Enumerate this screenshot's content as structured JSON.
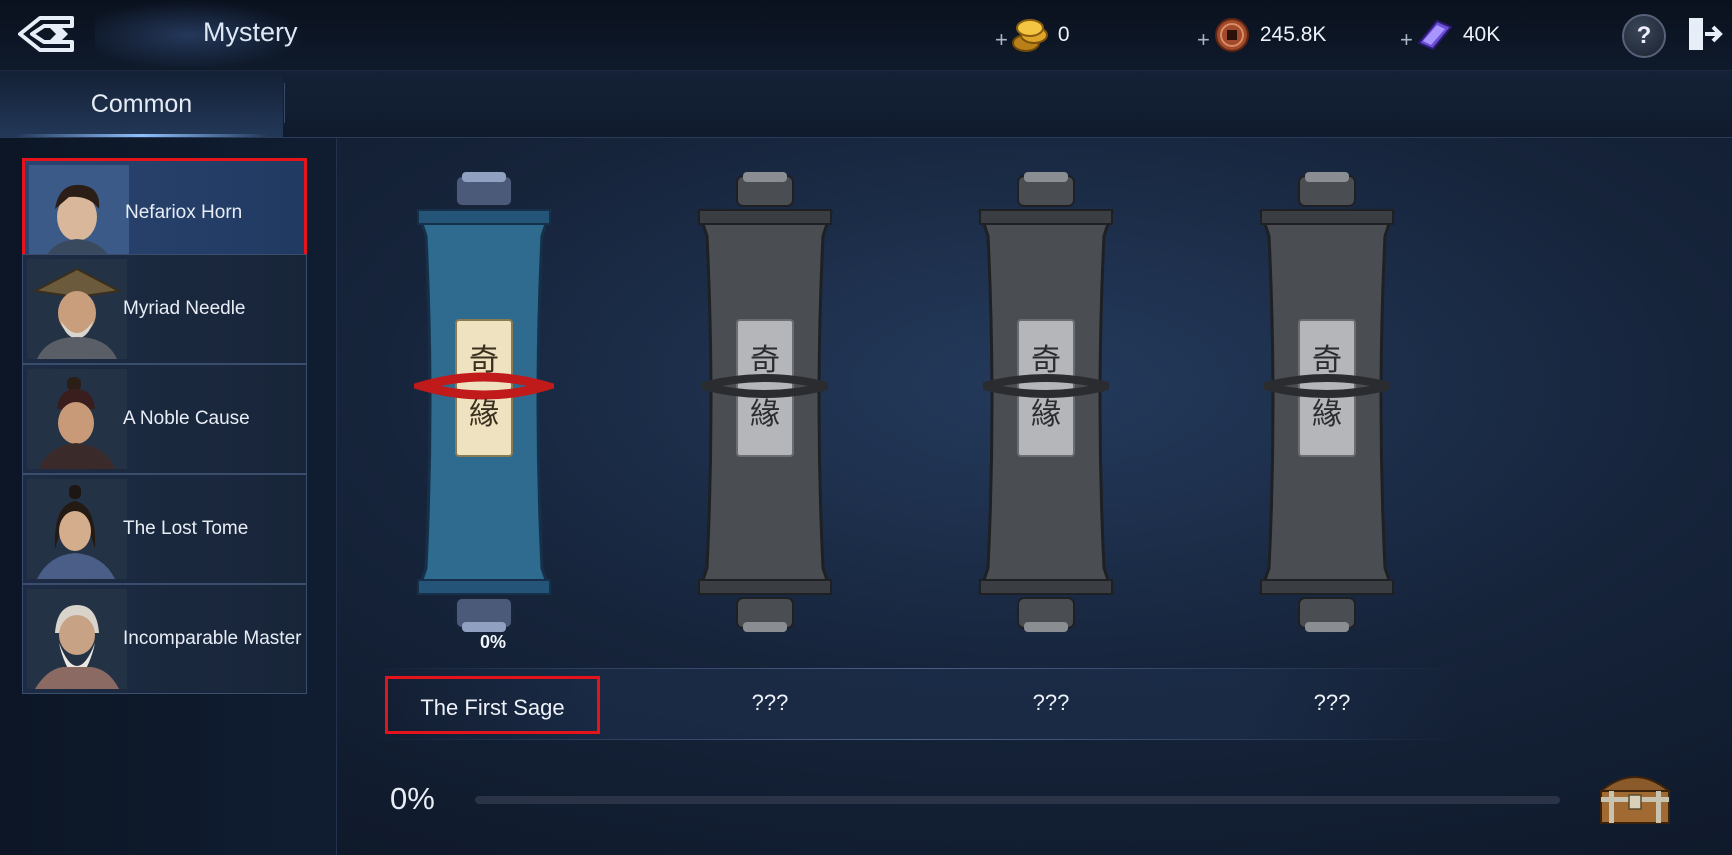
{
  "header": {
    "title": "Mystery",
    "currencies": [
      {
        "icon": "gold-coin-icon",
        "plus": "+",
        "value": "0"
      },
      {
        "icon": "copper-coin-icon",
        "plus": "+",
        "value": "245.8K"
      },
      {
        "icon": "purple-ingot-icon",
        "plus": "+",
        "value": "40K"
      }
    ],
    "help_label": "?"
  },
  "tabs": [
    {
      "label": "Common"
    }
  ],
  "sidebar": {
    "items": [
      {
        "label": "Nefariox Horn",
        "selected": true
      },
      {
        "label": "Myriad Needle"
      },
      {
        "label": "A Noble Cause"
      },
      {
        "label": "The Lost Tome"
      },
      {
        "label": "Incomparable Master"
      }
    ]
  },
  "scrolls": [
    {
      "name": "The First Sage",
      "progress_label": "0%",
      "unlocked": true,
      "seal_text": "奇緣"
    },
    {
      "name": "???",
      "unlocked": false,
      "seal_text": "奇緣"
    },
    {
      "name": "???",
      "unlocked": false,
      "seal_text": "奇緣"
    },
    {
      "name": "???",
      "unlocked": false,
      "seal_text": "奇緣"
    }
  ],
  "overall": {
    "progress_label": "0%",
    "progress_fraction": 0
  },
  "colors": {
    "accent": "#6ba1e6",
    "highlight_border": "#e4141a",
    "scroll_unlocked": "#2f6a8f",
    "scroll_locked": "#4a4d52"
  }
}
